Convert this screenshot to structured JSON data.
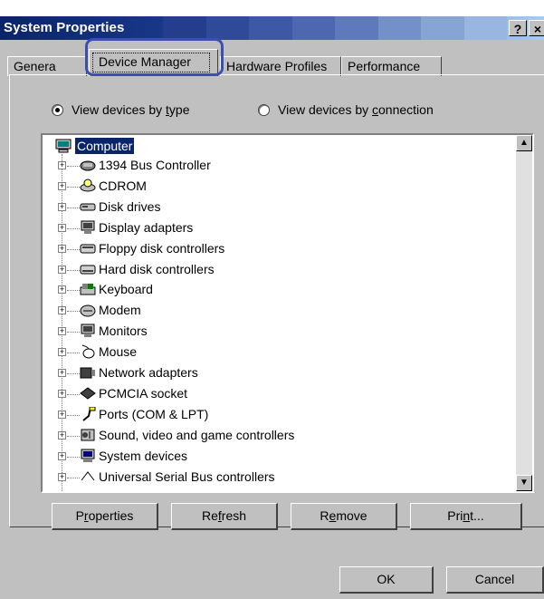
{
  "caption": "Device Manager tab of the System Properties dialog",
  "window": {
    "title": "System Properties",
    "help_glyph": "?",
    "close_glyph": "×"
  },
  "tabs": [
    {
      "label": "General",
      "visible_text": "Genera"
    },
    {
      "label": "Device Manager"
    },
    {
      "label": "Hardware Profiles"
    },
    {
      "label": "Performance"
    }
  ],
  "view": {
    "by_type": {
      "pre": "View devices by ",
      "accel": "t",
      "post": "ype",
      "selected": true
    },
    "by_connection": {
      "pre": "View devices by ",
      "accel": "c",
      "post": "onnection",
      "selected": false
    }
  },
  "tree": {
    "root": "Computer",
    "items": [
      {
        "label": "1394 Bus Controller",
        "icon": "bus-controller-icon"
      },
      {
        "label": "CDROM",
        "icon": "cdrom-icon"
      },
      {
        "label": "Disk drives",
        "icon": "disk-drive-icon"
      },
      {
        "label": "Display adapters",
        "icon": "display-adapter-icon"
      },
      {
        "label": "Floppy disk controllers",
        "icon": "floppy-controller-icon"
      },
      {
        "label": "Hard disk controllers",
        "icon": "hard-disk-controller-icon"
      },
      {
        "label": "Keyboard",
        "icon": "keyboard-icon"
      },
      {
        "label": "Modem",
        "icon": "modem-icon"
      },
      {
        "label": "Monitors",
        "icon": "monitor-icon"
      },
      {
        "label": "Mouse",
        "icon": "mouse-icon"
      },
      {
        "label": "Network adapters",
        "icon": "network-adapter-icon"
      },
      {
        "label": "PCMCIA socket",
        "icon": "pcmcia-icon"
      },
      {
        "label": "Ports (COM & LPT)",
        "icon": "port-icon"
      },
      {
        "label": "Sound, video and game controllers",
        "icon": "sound-icon"
      },
      {
        "label": "System devices",
        "icon": "system-device-icon"
      },
      {
        "label": "Universal Serial Bus controllers",
        "icon": "usb-icon"
      }
    ]
  },
  "buttons": {
    "properties": {
      "pre": "P",
      "accel": "r",
      "post": "operties"
    },
    "refresh": {
      "pre": "Re",
      "accel": "f",
      "post": "resh"
    },
    "remove": {
      "pre": "R",
      "accel": "e",
      "post": "move"
    },
    "print": {
      "pre": "Pri",
      "accel": "n",
      "post": "t..."
    },
    "ok": "OK",
    "cancel": "Cancel"
  },
  "colors": {
    "title_active": "#0a246a",
    "face": "#c0c0c0",
    "selection": "#0a246a",
    "highlight_ring": "#3a4fb0"
  }
}
